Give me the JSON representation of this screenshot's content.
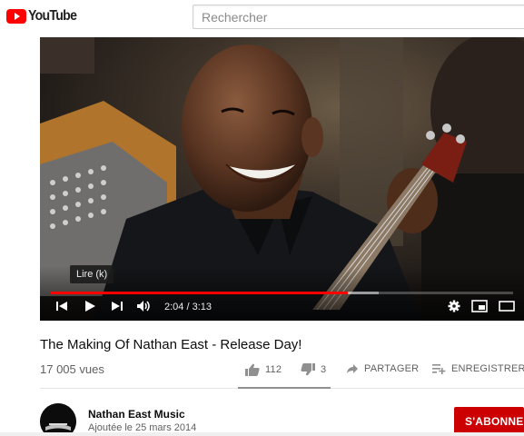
{
  "header": {
    "logo_text": "YouTube",
    "search_placeholder": "Rechercher"
  },
  "player": {
    "tooltip": "Lire (k)",
    "time_display": "2:04 / 3:13",
    "progress_fraction": 0.642,
    "buffered_fraction": 0.71,
    "accent_color": "#ff0000",
    "controls": [
      "previous-icon",
      "play-icon",
      "next-icon",
      "volume-icon",
      "settings-icon",
      "miniplayer-icon",
      "theater-icon"
    ]
  },
  "video": {
    "title": "The Making Of Nathan East - Release Day!",
    "views": "17 005 vues",
    "likes": "112",
    "dislikes": "3",
    "like_ratio": 0.974,
    "share_label": "PARTAGER",
    "save_label": "ENREGISTRER"
  },
  "channel": {
    "name": "Nathan East Music",
    "upload_date": "Ajoutée le 25 mars 2014",
    "subscribe_label": "S'ABONNER",
    "subscribe_color": "#cc0000"
  }
}
